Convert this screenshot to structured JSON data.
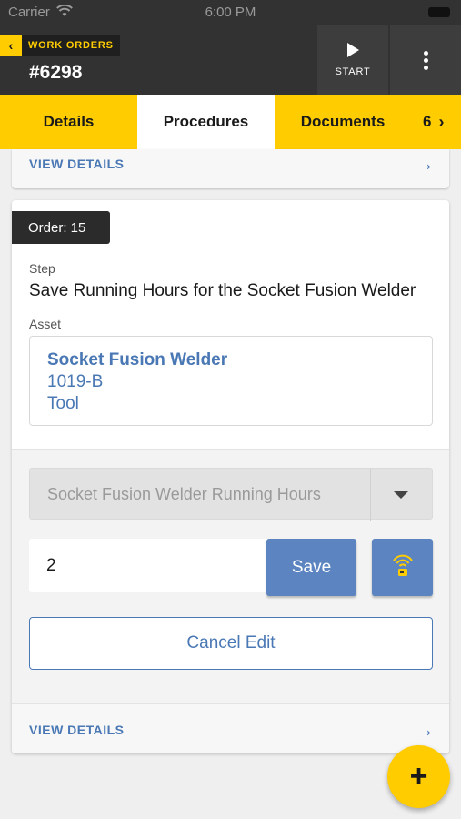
{
  "status_bar": {
    "carrier": "Carrier",
    "time": "6:00 PM"
  },
  "header": {
    "back_label": "WORK ORDERS",
    "title": "#6298",
    "start_label": "START"
  },
  "tabs": [
    {
      "label": "Details",
      "active": false
    },
    {
      "label": "Procedures",
      "active": true
    },
    {
      "label": "Documents",
      "active": false
    },
    {
      "label": "6",
      "active": false
    }
  ],
  "top_card": {
    "link_label": "VIEW DETAILS"
  },
  "procedure": {
    "order_label": "Order: 15",
    "step_label": "Step",
    "step_text": "Save Running Hours for the Socket Fusion Welder",
    "asset_label": "Asset",
    "asset": {
      "name": "Socket Fusion Welder",
      "code": "1019-B",
      "type": "Tool"
    },
    "meter_select": {
      "selected": "Socket Fusion Welder Running Hours"
    },
    "reading_input": {
      "value": "2"
    },
    "save_label": "Save",
    "cancel_label": "Cancel Edit",
    "footer_link_label": "VIEW DETAILS"
  },
  "colors": {
    "accent": "#ffcc00",
    "primary_blue": "#5b84c0",
    "header_bg": "#323232"
  },
  "icons": [
    "wifi-icon",
    "battery-icon",
    "chevron-left-icon",
    "play-icon",
    "more-vertical-icon",
    "chevron-right-icon",
    "arrow-right-icon",
    "dropdown-caret-icon",
    "rfid-scan-icon",
    "plus-icon"
  ]
}
